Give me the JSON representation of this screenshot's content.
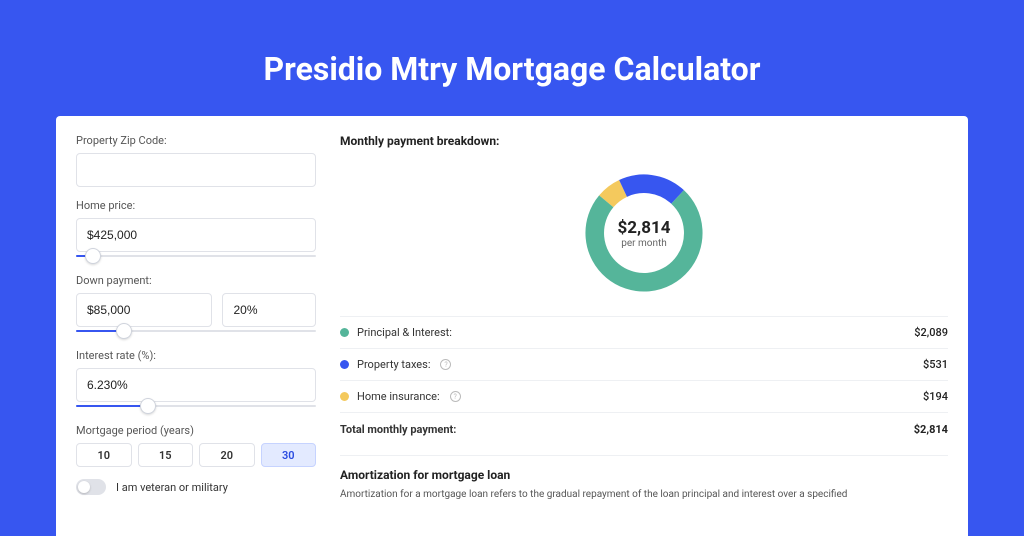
{
  "title": "Presidio Mtry Mortgage Calculator",
  "form": {
    "zip_label": "Property Zip Code:",
    "zip_value": "",
    "price_label": "Home price:",
    "price_value": "$425,000",
    "price_slider_pct": 7,
    "down_label": "Down payment:",
    "down_value": "$85,000",
    "down_pct_value": "20%",
    "down_slider_pct": 20,
    "rate_label": "Interest rate (%):",
    "rate_value": "6.230%",
    "rate_slider_pct": 30,
    "term_label": "Mortgage period (years)",
    "terms": [
      {
        "label": "10",
        "active": false
      },
      {
        "label": "15",
        "active": false
      },
      {
        "label": "20",
        "active": false
      },
      {
        "label": "30",
        "active": true
      }
    ],
    "veteran_label": "I am veteran or military",
    "veteran_on": false
  },
  "breakdown": {
    "title": "Monthly payment breakdown:",
    "center_amount": "$2,814",
    "center_sub": "per month",
    "rows": [
      {
        "key": "pi",
        "label": "Principal & Interest:",
        "value": "$2,089",
        "dot": "#55b59a",
        "info": false
      },
      {
        "key": "tax",
        "label": "Property taxes:",
        "value": "$531",
        "dot": "#3756f0",
        "info": true
      },
      {
        "key": "ins",
        "label": "Home insurance:",
        "value": "$194",
        "dot": "#f4c95d",
        "info": true
      }
    ],
    "total_label": "Total monthly payment:",
    "total_value": "$2,814"
  },
  "chart_data": {
    "type": "pie",
    "title": "Monthly payment breakdown",
    "categories": [
      "Principal & Interest",
      "Property taxes",
      "Home insurance"
    ],
    "values": [
      2089,
      531,
      194
    ],
    "colors": [
      "#55b59a",
      "#3756f0",
      "#f4c95d"
    ],
    "total": 2814
  },
  "amortization": {
    "title": "Amortization for mortgage loan",
    "text": "Amortization for a mortgage loan refers to the gradual repayment of the loan principal and interest over a specified"
  }
}
